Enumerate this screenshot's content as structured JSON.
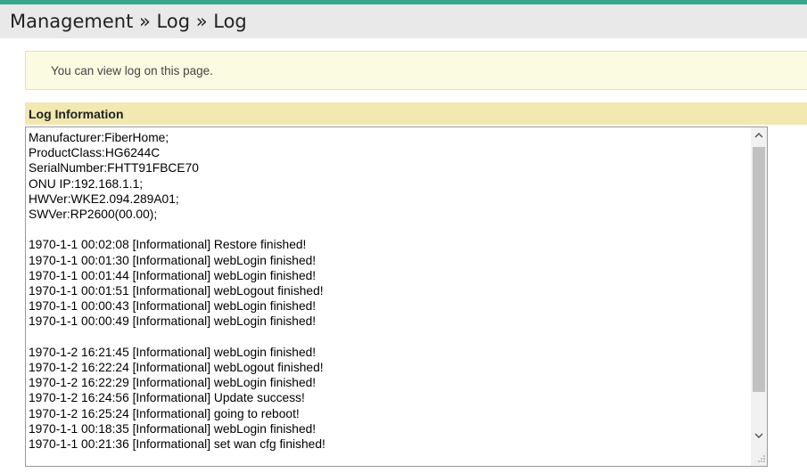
{
  "header": {
    "breadcrumb": "Management » Log » Log"
  },
  "notice": {
    "text": "You can view log on this page."
  },
  "section": {
    "title": "Log Information"
  },
  "log": {
    "lines": [
      "Manufacturer:FiberHome;",
      "ProductClass:HG6244C",
      "SerialNumber:FHTT91FBCE70",
      "ONU IP:192.168.1.1;",
      "HWVer:WKE2.094.289A01;",
      "SWVer:RP2600(00.00);",
      "",
      "1970-1-1 00:02:08 [Informational] Restore finished!",
      "1970-1-1 00:01:30 [Informational] webLogin finished!",
      "1970-1-1 00:01:44 [Informational] webLogin finished!",
      "1970-1-1 00:01:51 [Informational] webLogout finished!",
      "1970-1-1 00:00:43 [Informational] webLogin finished!",
      "1970-1-1 00:00:49 [Informational] webLogin finished!",
      "",
      "1970-1-2 16:21:45 [Informational] webLogin finished!",
      "1970-1-2 16:22:24 [Informational] webLogout finished!",
      "1970-1-2 16:22:29 [Informational] webLogin finished!",
      "1970-1-2 16:24:56 [Informational] Update success!",
      "1970-1-2 16:25:24 [Informational] going to reboot!",
      "1970-1-1 00:18:35 [Informational] webLogin finished!",
      "1970-1-1 00:21:36 [Informational] set wan cfg finished!"
    ]
  },
  "icons": {
    "scroll_up": "chevron-up-icon",
    "scroll_down": "chevron-down-icon",
    "resize": "resize-grip-icon"
  },
  "colors": {
    "accent": "#3aa58c",
    "header_bg": "#e9e9e9",
    "notice_bg": "#fbfbe2",
    "section_bg": "#f1e8b2"
  }
}
